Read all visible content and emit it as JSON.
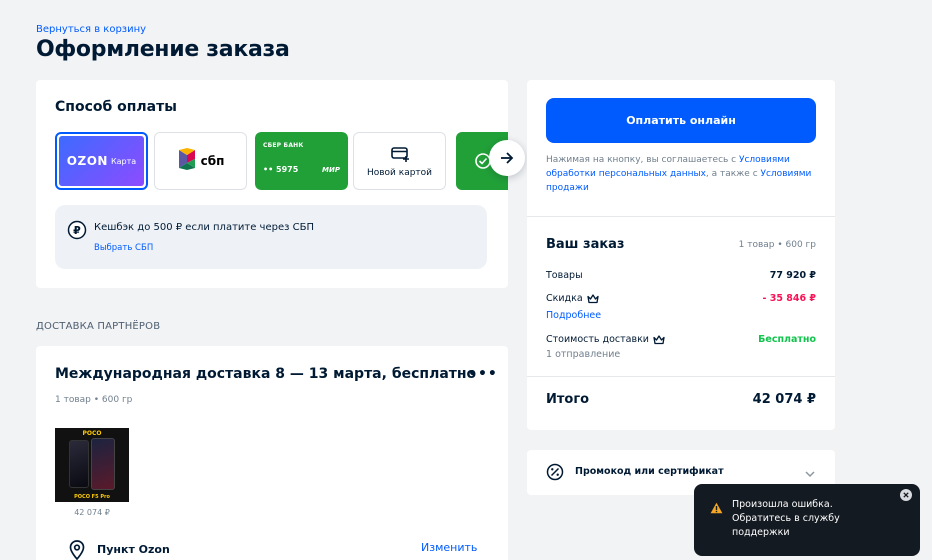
{
  "header": {
    "back_link": "Вернуться в корзину",
    "title": "Оформление заказа"
  },
  "payment": {
    "title": "Способ оплаты",
    "methods": [
      {
        "id": "ozon-card",
        "brand": "OZON",
        "label": "Карта",
        "selected": true
      },
      {
        "id": "sbp",
        "label": "сбп",
        "selected": false
      },
      {
        "id": "sber",
        "bank": "СБЕР БАНК",
        "number": "•• 5975",
        "network": "МИР",
        "selected": false
      },
      {
        "id": "new-card",
        "label": "Новой картой",
        "selected": false
      }
    ],
    "cashback_text": "Кешбэк до 500 ₽ если платите через СБП",
    "cashback_link": "Выбрать СБП"
  },
  "delivery": {
    "section_label": "ДОСТАВКА ПАРТНЁРОВ",
    "title": "Международная доставка 8 — 13 марта, бесплатно",
    "meta": "1 товар • 600 гр",
    "product": {
      "brand": "POCO",
      "model": "POCO F5 Pro",
      "price": "42 074 ₽"
    },
    "pickup_label": "Пункт Ozon",
    "change_link": "Изменить"
  },
  "sidebar": {
    "pay_button": "Оплатить онлайн",
    "agree_prefix": "Нажимая на кнопку, вы соглашаетесь с ",
    "agree_link1": "Условиями обработки персональных данных",
    "agree_middle": ", а также с ",
    "agree_link2": "Условиями продажи",
    "order_title": "Ваш заказ",
    "order_meta": "1 товар • 600 гр",
    "goods_label": "Товары",
    "goods_value": "77 920 ₽",
    "discount_label": "Скидка",
    "discount_value": "- 35 846 ₽",
    "discount_link": "Подробнее",
    "shipping_label": "Стоимость доставки",
    "shipping_value": "Бесплатно",
    "shipping_sub": "1 отправление",
    "total_label": "Итого",
    "total_value": "42 074 ₽",
    "promo_label": "Промокод или сертификат"
  },
  "toast": {
    "message": "Произошла ошибка. Обратитесь в службу поддержки"
  },
  "colors": {
    "accent": "#005bff",
    "discount": "#f91155",
    "success": "#10c44c",
    "sber_green": "#21a038",
    "warning": "#f5a623"
  }
}
